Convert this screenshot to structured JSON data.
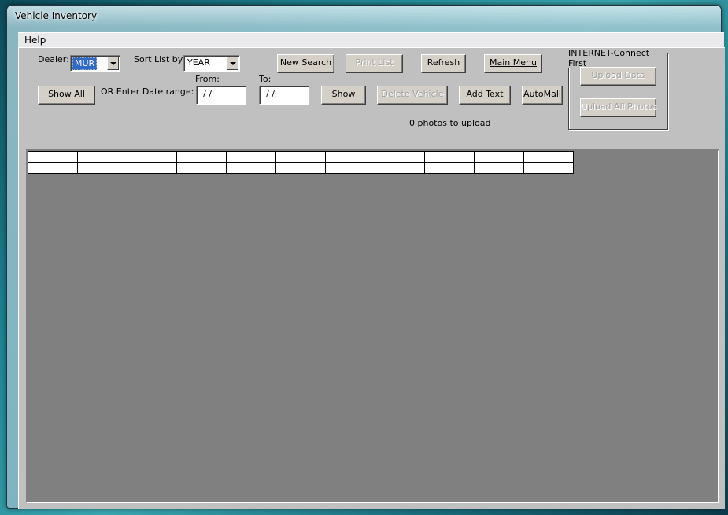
{
  "window": {
    "title": "Vehicle Inventory"
  },
  "menu": {
    "items": [
      "Help"
    ]
  },
  "toolbar": {
    "dealer_label": "Dealer:",
    "dealer_value": "MUR",
    "sort_label": "Sort List by:",
    "sort_value": "YEAR",
    "show_all": "Show All",
    "date_range_label": "OR Enter Date range:",
    "from_label": "From:",
    "to_label": "To:",
    "from_value": " /  /",
    "to_value": " /  /",
    "new_search": "New Search",
    "print_list": "Print List",
    "refresh": "Refresh",
    "main_menu": "Main Menu",
    "show": "Show",
    "delete_vehicle": "Delete Vehicle",
    "add_text": "Add Text",
    "automall": "AutoMall",
    "photos_status": "0 photos to upload"
  },
  "internet_group": {
    "title": "INTERNET-Connect First",
    "upload_data": "Upload Data",
    "upload_all_photos": "Upload All Photos"
  },
  "grid": {
    "column_count": 11,
    "row_count": 1
  }
}
